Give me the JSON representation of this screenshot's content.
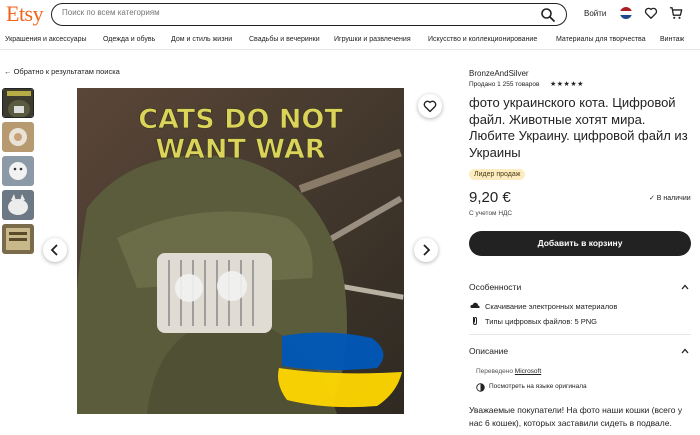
{
  "header": {
    "logo": "Etsy",
    "search_placeholder": "Поиск по всем категориям",
    "login_label": "Войти",
    "icons": [
      "search-icon",
      "netherlands-flag-icon",
      "heart-icon",
      "cart-icon"
    ]
  },
  "categories": [
    "Украшения и аксессуары",
    "Одежда и обувь",
    "Дом и стиль жизни",
    "Свадьбы и вечеринки",
    "Игрушки и развлечения",
    "Искусство и коллекционирование",
    "Материалы для творчества",
    "Винтаж"
  ],
  "gallery": {
    "back_link": "← Обратно к результатам поиска",
    "image_text": [
      "CATS DO NOT",
      "WANT WAR"
    ],
    "thumbnail_count": 5,
    "active_thumbnail": 1
  },
  "listing": {
    "shop_name": "BronzeAndSilver",
    "sales": "Продано 1 255 товаров",
    "stars": "★★★★★",
    "title": "фото украинского кота. Цифровой файл. Животные хотят мира. Любите Украину. цифровой файл из Украины",
    "badge": "Лидер продаж",
    "price": "9,20 €",
    "vat": "С учетом НДС",
    "stock": "✓ В наличии",
    "cart_button": "Добавить в корзину"
  },
  "features": {
    "title": "Особенности",
    "items": [
      {
        "icon": "download-icon",
        "text": "Скачивание электронных материалов"
      },
      {
        "icon": "file-icon",
        "text": "Типы цифровых файлов: 5 PNG"
      }
    ]
  },
  "description": {
    "title": "Описание",
    "translated_prefix": "Переведено",
    "translated_by": "Microsoft",
    "show_original": "Посмотреть на языке оригинала",
    "text": "Уважаемые покупатели! На фото наши кошки (всего у нас 6 кошек), которых заставили сидеть в подвале."
  },
  "colors": {
    "brand": "#f1641e",
    "button": "#222222",
    "badge_bg": "#fcecc0",
    "flag_blue": "#0057b7",
    "flag_yellow": "#ffd700"
  }
}
